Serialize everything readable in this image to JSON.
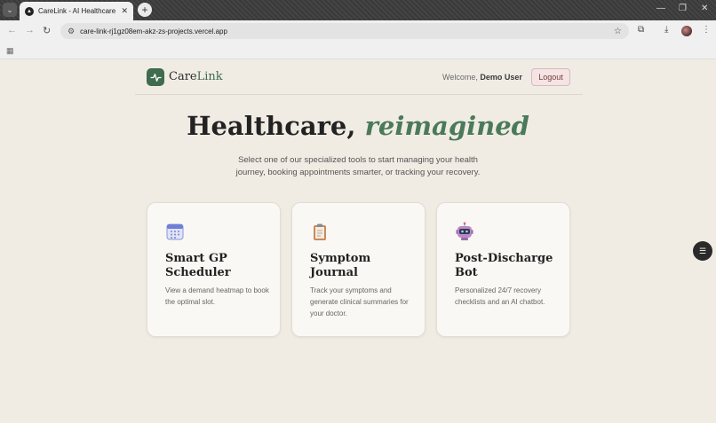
{
  "browser": {
    "tab_title": "CareLink - AI Healthcare",
    "url": "care-link-rj1gz08em-akz-zs-projects.vercel.app",
    "new_tab_symbol": "+",
    "close_symbol": "✕"
  },
  "header": {
    "brand_prefix": "Care",
    "brand_suffix": "Link",
    "welcome_prefix": "Welcome,",
    "user_name": "Demo User",
    "logout_label": "Logout"
  },
  "hero": {
    "title_plain": "Healthcare,",
    "title_emphasis": "reimagined",
    "subtitle": "Select one of our specialized tools to start managing your health journey, booking appointments smarter, or tracking your recovery."
  },
  "cards": [
    {
      "icon": "calendar-icon",
      "title": "Smart GP Scheduler",
      "description": "View a demand heatmap to book the optimal slot."
    },
    {
      "icon": "clipboard-icon",
      "title": "Symptom Journal",
      "description": "Track your symptoms and generate clinical summaries for your doctor."
    },
    {
      "icon": "robot-icon",
      "title": "Post-Discharge Bot",
      "description": "Personalized 24/7 recovery checklists and an AI chatbot."
    }
  ],
  "colors": {
    "brand_green": "#3f6b4e",
    "page_bg": "#f0ece4",
    "logout_bg": "#f4e4e4"
  }
}
